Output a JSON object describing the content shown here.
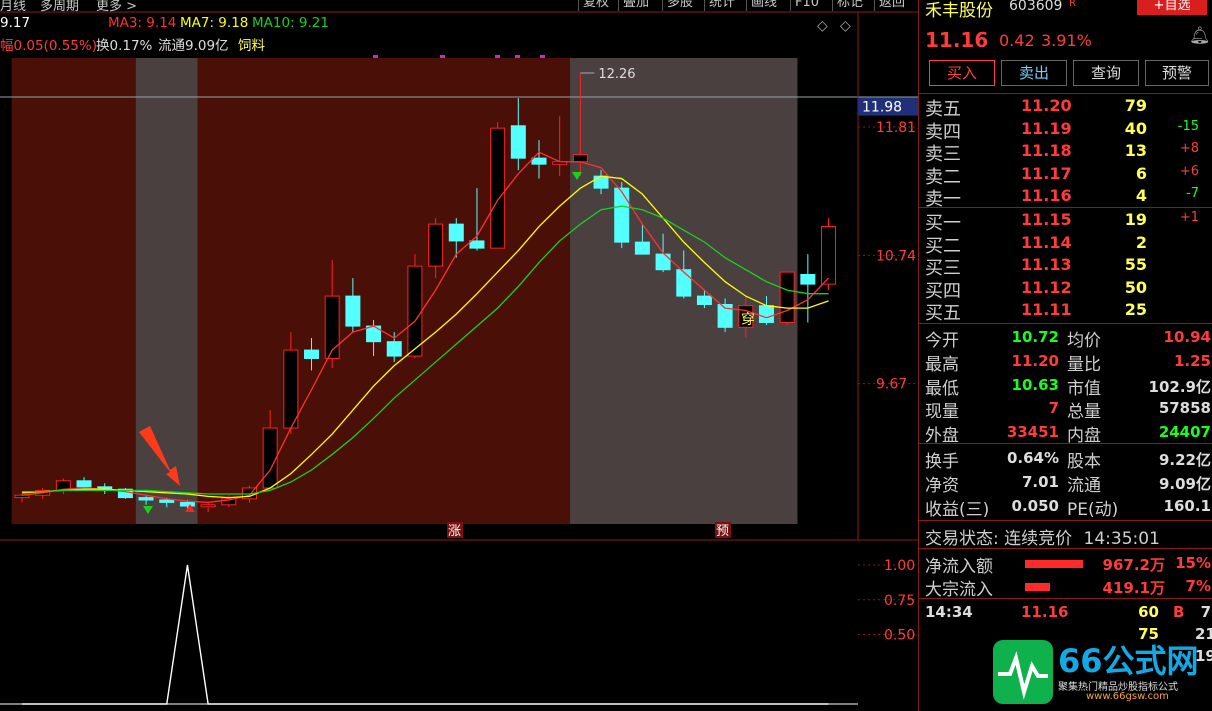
{
  "toolbar": {
    "left_items": [
      "月线",
      "多周期",
      "更多 >"
    ],
    "buttons": [
      "复权",
      "叠加",
      "多股",
      "统计",
      "画线",
      "F10",
      "标记",
      "返回"
    ]
  },
  "indicators": {
    "first_value": "9.17",
    "ma3": "MA3: 9.14",
    "ma7": "MA7: 9.18",
    "ma10": "MA10: 9.21",
    "change_text": "幅0.05(0.55%)",
    "turnover_text": "换0.17%",
    "float_text": "流通9.09亿",
    "sector_text": "饲料"
  },
  "colors": {
    "up": "#ff2020",
    "down": "#54ffff",
    "ma3": "#ff3030",
    "ma7": "#ffff00",
    "ma10": "#19d119",
    "zone_red": "#4a1008",
    "zone_gray": "#4a4040",
    "accent": "#ff3b3b"
  },
  "chart_data": {
    "type": "candlestick",
    "y_ticks": [
      "11.81",
      "10.74",
      "9.67"
    ],
    "y_highlight": "11.98",
    "high_label": "12.26",
    "markers": {
      "zhang": "涨",
      "yu": "预",
      "chuan": "穿"
    },
    "sub_ticks": [
      "1.00",
      "0.75",
      "0.50"
    ],
    "candles": [
      [
        8.72,
        8.75,
        8.68,
        8.74
      ],
      [
        8.74,
        8.8,
        8.71,
        8.78
      ],
      [
        8.78,
        8.88,
        8.75,
        8.86
      ],
      [
        8.86,
        8.89,
        8.78,
        8.81
      ],
      [
        8.81,
        8.84,
        8.75,
        8.79
      ],
      [
        8.79,
        8.8,
        8.71,
        8.72
      ],
      [
        8.72,
        8.74,
        8.66,
        8.7
      ],
      [
        8.7,
        8.72,
        8.64,
        8.68
      ],
      [
        8.68,
        8.7,
        8.6,
        8.65
      ],
      [
        8.65,
        8.68,
        8.6,
        8.66
      ],
      [
        8.66,
        8.74,
        8.64,
        8.71
      ],
      [
        8.71,
        8.82,
        8.68,
        8.8
      ],
      [
        8.8,
        9.45,
        8.8,
        9.3
      ],
      [
        9.3,
        10.1,
        9.25,
        9.95
      ],
      [
        9.95,
        10.05,
        9.78,
        9.88
      ],
      [
        9.88,
        10.7,
        9.8,
        10.4
      ],
      [
        10.4,
        10.55,
        10.1,
        10.15
      ],
      [
        10.15,
        10.2,
        9.9,
        10.02
      ],
      [
        10.02,
        10.1,
        9.85,
        9.9
      ],
      [
        9.9,
        10.75,
        9.88,
        10.65
      ],
      [
        10.65,
        11.05,
        10.55,
        11.0
      ],
      [
        11.0,
        11.05,
        10.72,
        10.86
      ],
      [
        10.86,
        11.3,
        10.78,
        10.8
      ],
      [
        10.8,
        11.85,
        10.8,
        11.8
      ],
      [
        11.82,
        12.05,
        11.45,
        11.55
      ],
      [
        11.55,
        11.7,
        11.38,
        11.5
      ],
      [
        11.5,
        11.9,
        11.4,
        11.52
      ],
      [
        11.52,
        12.26,
        11.4,
        11.58
      ],
      [
        11.4,
        11.45,
        11.25,
        11.3
      ],
      [
        11.3,
        11.35,
        10.8,
        10.85
      ],
      [
        10.85,
        11.0,
        10.75,
        10.75
      ],
      [
        10.75,
        10.92,
        10.6,
        10.62
      ],
      [
        10.62,
        10.78,
        10.38,
        10.4
      ],
      [
        10.4,
        10.45,
        10.3,
        10.33
      ],
      [
        10.33,
        10.38,
        10.1,
        10.14
      ],
      [
        10.14,
        10.4,
        10.05,
        10.32
      ],
      [
        10.32,
        10.4,
        10.16,
        10.18
      ],
      [
        10.18,
        10.6,
        10.16,
        10.6
      ],
      [
        10.58,
        10.75,
        10.18,
        10.5
      ],
      [
        10.5,
        11.05,
        10.45,
        10.98
      ]
    ],
    "ma3": [
      8.74,
      8.76,
      8.79,
      8.8,
      8.79,
      8.77,
      8.74,
      8.71,
      8.69,
      8.68,
      8.7,
      8.74,
      8.95,
      9.3,
      9.62,
      9.95,
      10.1,
      10.15,
      10.05,
      10.19,
      10.45,
      10.75,
      10.9,
      11.2,
      11.42,
      11.6,
      11.52,
      11.52,
      11.47,
      11.27,
      11.0,
      10.76,
      10.6,
      10.45,
      10.3,
      10.28,
      10.22,
      10.28,
      10.37,
      10.55
    ],
    "ma7": [
      8.76,
      8.77,
      8.78,
      8.79,
      8.79,
      8.78,
      8.77,
      8.76,
      8.75,
      8.73,
      8.72,
      8.73,
      8.8,
      8.92,
      9.08,
      9.25,
      9.45,
      9.65,
      9.82,
      9.96,
      10.1,
      10.25,
      10.42,
      10.6,
      10.78,
      10.98,
      11.15,
      11.3,
      11.4,
      11.38,
      11.25,
      11.05,
      10.85,
      10.68,
      10.52,
      10.4,
      10.32,
      10.3,
      10.3,
      10.36
    ],
    "ma10": [
      8.77,
      8.77,
      8.78,
      8.78,
      8.78,
      8.78,
      8.78,
      8.77,
      8.76,
      8.75,
      8.75,
      8.75,
      8.78,
      8.85,
      8.95,
      9.08,
      9.22,
      9.38,
      9.55,
      9.7,
      9.85,
      10.0,
      10.15,
      10.3,
      10.48,
      10.68,
      10.86,
      11.0,
      11.12,
      11.15,
      11.12,
      11.05,
      10.95,
      10.85,
      10.72,
      10.62,
      10.52,
      10.45,
      10.42,
      10.42
    ],
    "sub_series": [
      0,
      0,
      0,
      0,
      0,
      0,
      0,
      0,
      1,
      0,
      0,
      0,
      0,
      0,
      0,
      0,
      0,
      0,
      0,
      0,
      0,
      0,
      0,
      0,
      0,
      0,
      0,
      0,
      0,
      0,
      0,
      0,
      0,
      0,
      0,
      0,
      0,
      0,
      0,
      0
    ]
  },
  "stock": {
    "name": "禾丰股份",
    "code": "603609",
    "tag": "R",
    "add_watch": "+自选",
    "price": "11.16",
    "change": "0.42",
    "change_pct": "3.91%"
  },
  "actions": [
    "买入",
    "卖出",
    "查询",
    "预警"
  ],
  "asks": [
    {
      "label": "卖五",
      "price": "11.20",
      "vol": "79",
      "chg": ""
    },
    {
      "label": "卖四",
      "price": "11.19",
      "vol": "40",
      "chg": "-15"
    },
    {
      "label": "卖三",
      "price": "11.18",
      "vol": "13",
      "chg": "+8"
    },
    {
      "label": "卖二",
      "price": "11.17",
      "vol": "6",
      "chg": "+6"
    },
    {
      "label": "卖一",
      "price": "11.16",
      "vol": "4",
      "chg": "-7"
    }
  ],
  "bids": [
    {
      "label": "买一",
      "price": "11.15",
      "vol": "19",
      "chg": "+1"
    },
    {
      "label": "买二",
      "price": "11.14",
      "vol": "2",
      "chg": ""
    },
    {
      "label": "买三",
      "price": "11.13",
      "vol": "55",
      "chg": ""
    },
    {
      "label": "买四",
      "price": "11.12",
      "vol": "50",
      "chg": ""
    },
    {
      "label": "买五",
      "price": "11.11",
      "vol": "25",
      "chg": ""
    }
  ],
  "quote": [
    {
      "l1": "今开",
      "v1": "10.72",
      "c1": "#19ff19",
      "l2": "均价",
      "v2": "10.94",
      "c2": "#ff3b3b"
    },
    {
      "l1": "最高",
      "v1": "11.20",
      "c1": "#ff3b3b",
      "l2": "量比",
      "v2": "1.25",
      "c2": "#ff3b3b"
    },
    {
      "l1": "最低",
      "v1": "10.63",
      "c1": "#19ff19",
      "l2": "市值",
      "v2": "102.9亿",
      "c2": "#dddddd"
    },
    {
      "l1": "现量",
      "v1": "7",
      "c1": "#ff3b3b",
      "l2": "总量",
      "v2": "57858",
      "c2": "#dddddd"
    },
    {
      "l1": "外盘",
      "v1": "33451",
      "c1": "#ff3b3b",
      "l2": "内盘",
      "v2": "24407",
      "c2": "#19ff19"
    }
  ],
  "fund": [
    {
      "l1": "换手",
      "v1": "0.64%",
      "l2": "股本",
      "v2": "9.22亿"
    },
    {
      "l1": "净资",
      "v1": "7.01",
      "l2": "流通",
      "v2": "9.09亿"
    },
    {
      "l1": "收益(三)",
      "v1": "0.050",
      "l2": "PE(动)",
      "v2": "160.1"
    }
  ],
  "trade_status": {
    "label": "交易状态:",
    "value": "连续竞价",
    "time": "14:35:01"
  },
  "flows": [
    {
      "label": "净流入额",
      "value": "967.2万",
      "pct": "15%",
      "fill": 1.0
    },
    {
      "label": "大宗流入",
      "value": "419.1万",
      "pct": "7%",
      "fill": 0.43
    }
  ],
  "ticks": [
    {
      "time": "14:34",
      "price": "11.16",
      "vol": "60",
      "side": "B",
      "n": "7"
    },
    {
      "time": "",
      "price": "",
      "vol": "75",
      "side": "",
      "n": "21"
    },
    {
      "time": "",
      "price": "",
      "vol": "",
      "side": "",
      "n": "19"
    }
  ],
  "logo": {
    "big": "66公式网",
    "sub": "聚集热门精品炒股指标公式",
    "url": "www.66gsw.com"
  }
}
